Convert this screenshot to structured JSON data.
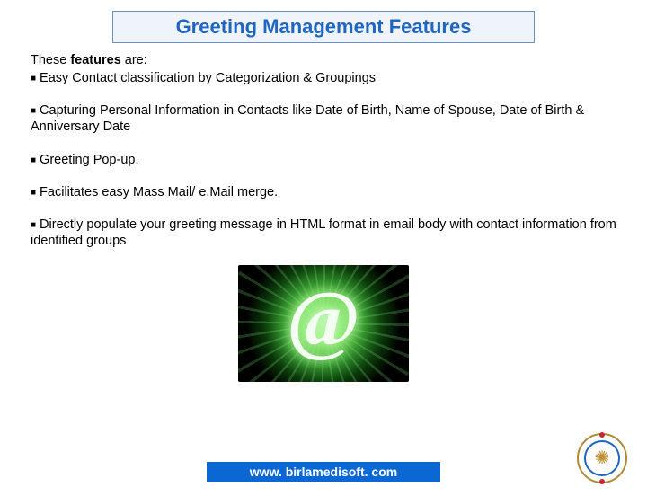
{
  "title": "Greeting Management Features",
  "intro": {
    "plain": "These ",
    "bold": "features",
    "tail": " are:"
  },
  "bullets": [
    "Easy Contact classification by Categorization & Groupings",
    "Capturing Personal Information in Contacts like  Date of Birth,  Name of Spouse, Date of Birth &  Anniversary Date",
    "Greeting Pop-up.",
    "Facilitates easy Mass Mail/ e.Mail merge.",
    "Directly populate your greeting message in HTML format in email body with contact information from identified groups"
  ],
  "figure": {
    "symbol": "@"
  },
  "footer": {
    "url": "www. birlamedisoft. com"
  }
}
